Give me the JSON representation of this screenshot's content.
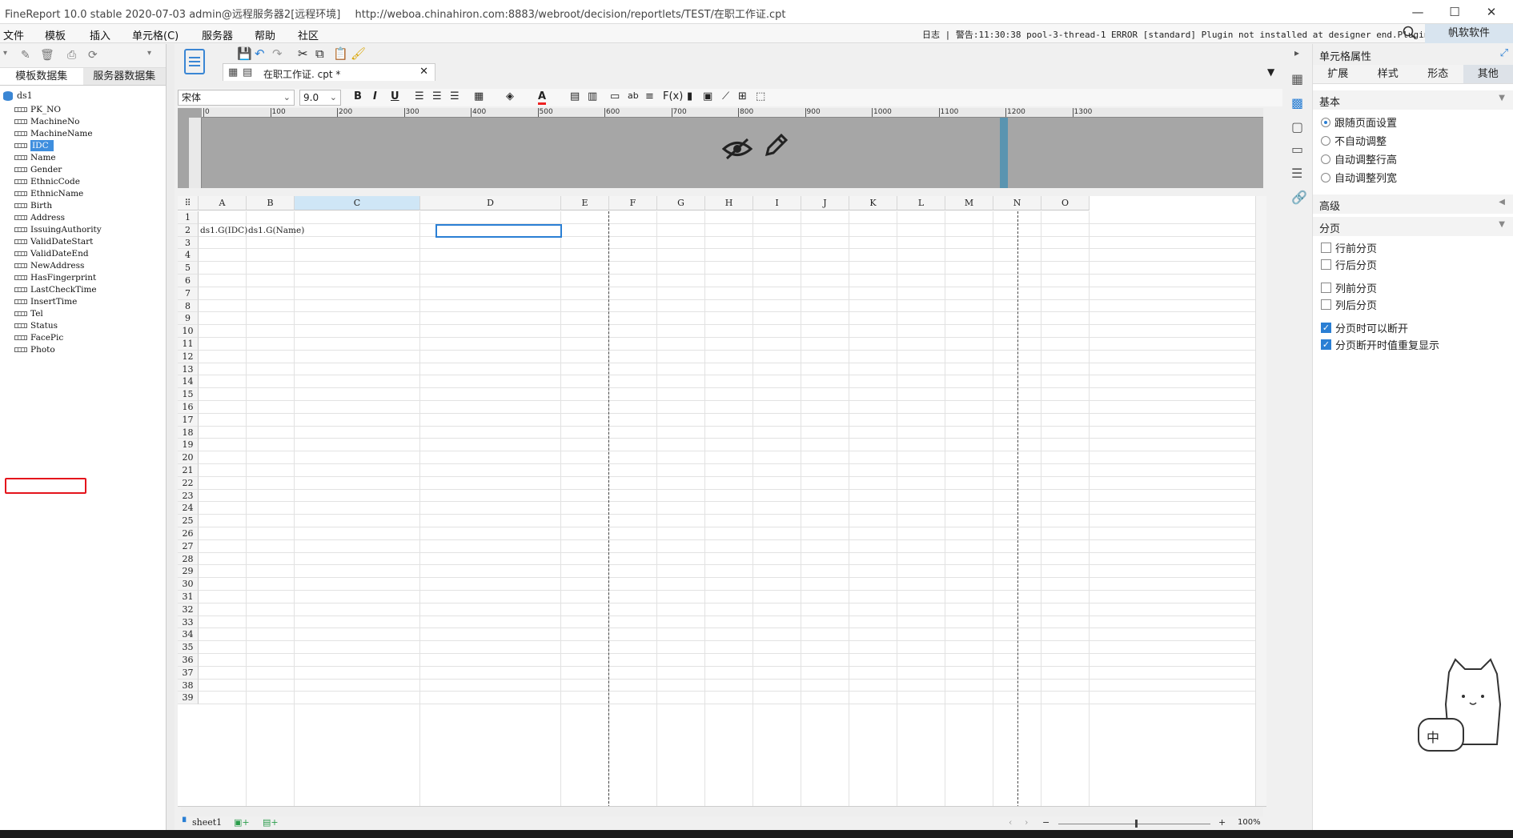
{
  "window": {
    "title": "FineReport 10.0 stable 2020-07-03 admin@远程服务器2[远程环境]",
    "url": "http://weboa.chinahiron.com:8883/webroot/decision/reportlets/TEST/在职工作证.cpt",
    "minimize": "—",
    "maximize": "☐",
    "close": "✕"
  },
  "menu": {
    "items": [
      "文件",
      "模板",
      "插入",
      "单元格(C)",
      "服务器",
      "帮助",
      "社区"
    ],
    "log_label": "日志",
    "warning": "警告:11:30:38 pool-3-thread-1 ERROR [standard] Plugin not installed at designer end.Plugin...",
    "brand": "帆软软件"
  },
  "left": {
    "tab_template": "模板数据集",
    "tab_server": "服务器数据集",
    "dataset": "ds1",
    "fields": [
      "PK_NO",
      "MachineNo",
      "MachineName",
      "IDC",
      "Name",
      "Gender",
      "EthnicCode",
      "EthnicName",
      "Birth",
      "Address",
      "IssuingAuthority",
      "ValidDateStart",
      "ValidDateEnd",
      "NewAddress",
      "HasFingerprint",
      "LastCheckTime",
      "InsertTime",
      "Tel",
      "Status",
      "FacePic",
      "Photo"
    ],
    "selected_field": "IDC",
    "highlighted_field": "Photo"
  },
  "file_tab": {
    "name": "在职工作证. cpt *"
  },
  "format": {
    "font": "宋体",
    "size": "9.0",
    "bold": "B",
    "italic": "I",
    "underline": "U"
  },
  "ruler_ticks": [
    "0",
    "100",
    "200",
    "300",
    "400",
    "500",
    "600",
    "700",
    "800",
    "900",
    "1000",
    "1100",
    "1200",
    "1300"
  ],
  "columns": [
    "A",
    "B",
    "C",
    "D",
    "E",
    "F",
    "G",
    "H",
    "I",
    "J",
    "K",
    "L",
    "M",
    "N",
    "O"
  ],
  "rows": [
    "1",
    "2",
    "3",
    "4",
    "5",
    "6",
    "7",
    "8",
    "9",
    "10",
    "11",
    "12",
    "13",
    "14",
    "15",
    "16",
    "17",
    "18",
    "19",
    "20",
    "21",
    "22",
    "23",
    "24",
    "25",
    "26",
    "27",
    "28",
    "29",
    "30",
    "31",
    "32",
    "33",
    "34",
    "35",
    "36",
    "37",
    "38",
    "39"
  ],
  "cells": {
    "A2": "ds1.G(IDC)",
    "B2": "ds1.G(Name)"
  },
  "sheet": {
    "name": "sheet1",
    "zoom": "100%",
    "zoom_minus": "−",
    "zoom_plus": "+"
  },
  "right": {
    "title": "单元格属性",
    "tabs": [
      "扩展",
      "样式",
      "形态",
      "其他"
    ],
    "active_tab": "其他",
    "basic": "基本",
    "radios": [
      {
        "label": "跟随页面设置",
        "checked": true
      },
      {
        "label": "不自动调整",
        "checked": false
      },
      {
        "label": "自动调整行高",
        "checked": false
      },
      {
        "label": "自动调整列宽",
        "checked": false
      }
    ],
    "advanced": "高级",
    "paging": "分页",
    "checks": [
      {
        "label": "行前分页",
        "checked": false
      },
      {
        "label": "行后分页",
        "checked": false
      },
      {
        "label": "列前分页",
        "checked": false
      },
      {
        "label": "列后分页",
        "checked": false
      },
      {
        "label": "分页时可以断开",
        "checked": true
      },
      {
        "label": "分页断开时值重复显示",
        "checked": true
      }
    ]
  },
  "mascot": {
    "text": "中"
  },
  "colors": {
    "accent": "#2a7fd4",
    "selected": "#3e8ede",
    "highlight_box": "#e4141c"
  }
}
